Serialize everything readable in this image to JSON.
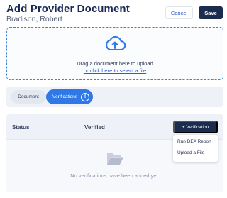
{
  "header": {
    "title": "Add Provider Document",
    "subtitle": "Bradison, Robert",
    "cancel_label": "Cancel",
    "save_label": "Save"
  },
  "upload": {
    "icon": "cloud-upload-icon",
    "instruction": "Drag a document here to upload",
    "link": "or click here to select a file"
  },
  "tabs": [
    {
      "label": "Document",
      "selected": false
    },
    {
      "label": "Verifications",
      "selected": true,
      "icon": "info-icon"
    }
  ],
  "verifications": {
    "columns": [
      "Status",
      "Verified"
    ],
    "add_button": "+ Verification",
    "menu": [
      "Run DEA Report",
      "Upload a File"
    ],
    "empty_icon": "empty-folder-icon",
    "empty_message": "No verifications have been added yet."
  },
  "colors": {
    "primary": "#1b2d4f",
    "accent": "#2e78e8",
    "link": "#2a5fd0"
  }
}
